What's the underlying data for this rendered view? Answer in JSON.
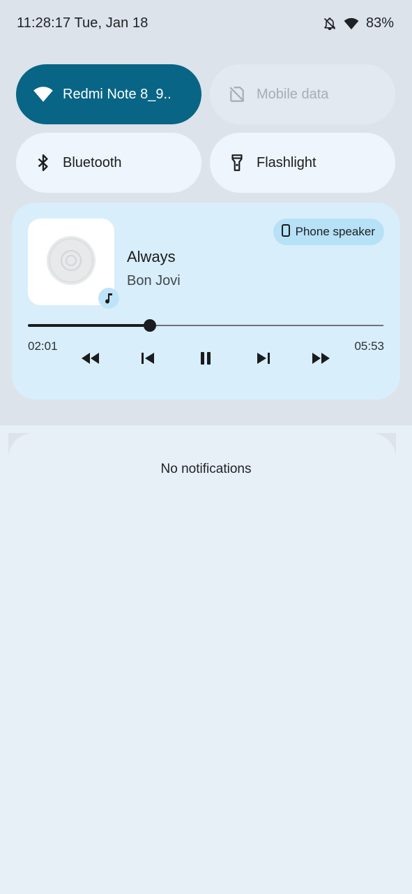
{
  "status_bar": {
    "clock": "11:28:17 Tue, Jan 18",
    "battery": "83%",
    "icons": [
      "notifications-off-icon",
      "wifi-icon",
      "battery-text"
    ]
  },
  "quick_tiles": [
    {
      "label": "Redmi Note 8_9..",
      "icon": "wifi-icon",
      "state": "on"
    },
    {
      "label": "Mobile data",
      "icon": "no-sim-icon",
      "state": "unavailable"
    },
    {
      "label": "Bluetooth",
      "icon": "bluetooth-icon",
      "state": "off"
    },
    {
      "label": "Flashlight",
      "icon": "flashlight-icon",
      "state": "off"
    }
  ],
  "media_player": {
    "title": "Always",
    "artist": "Bon Jovi",
    "output_device": "Phone speaker",
    "elapsed": "02:01",
    "duration": "05:53",
    "progress_fraction": 0.343,
    "controls": [
      "rewind-icon",
      "skip-previous-icon",
      "pause-icon",
      "skip-next-icon",
      "fast-forward-icon"
    ]
  },
  "notifications": {
    "empty_text": "No notifications"
  },
  "colors": {
    "accent_tile": "#086585",
    "media_card": "#d8eefa",
    "output_chip": "#b6e1f6",
    "shade_background": "#dde3ea",
    "notification_background": "#e8f0f7"
  }
}
